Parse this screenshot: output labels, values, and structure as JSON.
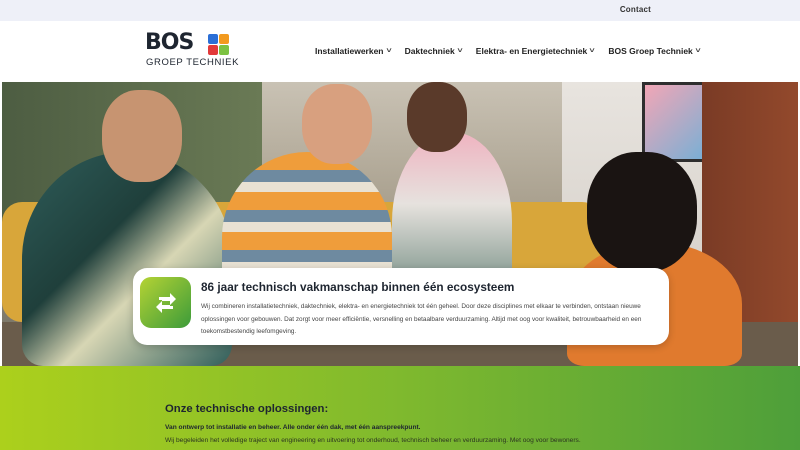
{
  "topbar": {
    "contact_label": "Contact"
  },
  "logo": {
    "word": "BOS",
    "subtitle": "GROEP TECHNIEK"
  },
  "nav": {
    "items": [
      {
        "label": "Installatiewerken"
      },
      {
        "label": "Daktechniek"
      },
      {
        "label": "Elektra- en Energietechniek"
      },
      {
        "label": "BOS Groep Techniek"
      }
    ],
    "chevron": "˅"
  },
  "hero": {
    "card": {
      "icon": "refresh-arrows-icon",
      "title": "86 jaar technisch vakmanschap binnen één ecosysteem",
      "text": "Wij combineren installatietechniek, daktechniek, elektra- en energietechniek tot één geheel. Door deze disciplines met elkaar te verbinden, ontstaan nieuwe oplossingen voor gebouwen. Dat zorgt voor meer efficiëntie, versnelling en betaalbare verduurzaming. Altijd met oog voor kwaliteit, betrouwbaarheid en een toekomstbestendig leefomgeving."
    }
  },
  "solutions": {
    "heading": "Onze technische oplossingen:",
    "lead": "Van ontwerp tot installatie en beheer. Alle onder één dak, met één aanspreekpunt.",
    "body": "Wij begeleiden het volledige traject van engineering en uitvoering tot onderhoud, technisch beheer en verduurzaming. Met oog voor bewoners."
  },
  "colors": {
    "brand_dark": "#1e2530",
    "green_start": "#acd01c",
    "green_end": "#4e9f3a",
    "topbar_bg": "#eef0f8"
  }
}
